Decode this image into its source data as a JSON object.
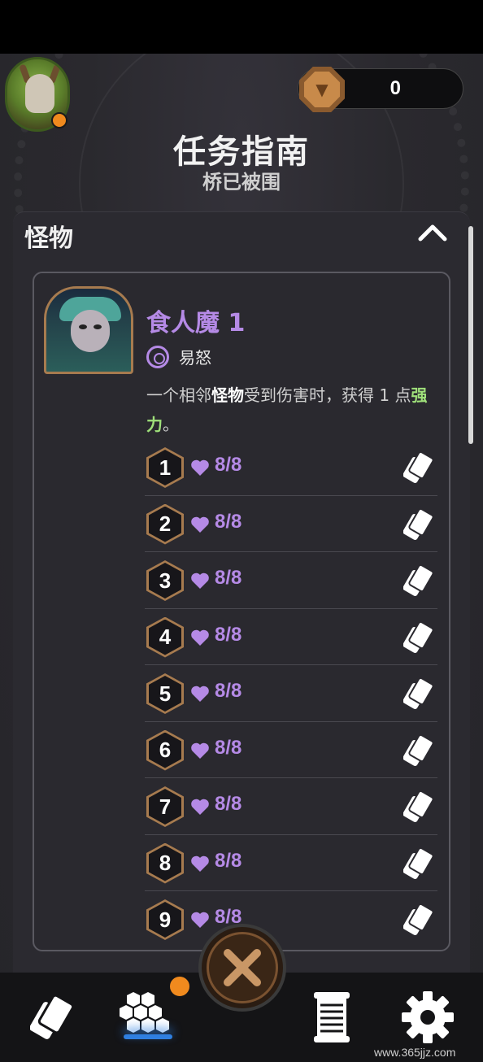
{
  "header": {
    "currency_value": "0",
    "title": "任务指南",
    "subtitle": "桥已被围"
  },
  "section": {
    "title": "怪物"
  },
  "monster": {
    "name": "食人魔 1",
    "trait": "易怒",
    "desc_parts": [
      "一个相邻",
      "怪物",
      "受到伤害时，获得 1 点",
      "强力",
      "。"
    ],
    "rows": [
      {
        "num": "1",
        "hp": "8/8"
      },
      {
        "num": "2",
        "hp": "8/8"
      },
      {
        "num": "3",
        "hp": "8/8"
      },
      {
        "num": "4",
        "hp": "8/8"
      },
      {
        "num": "5",
        "hp": "8/8"
      },
      {
        "num": "6",
        "hp": "8/8"
      },
      {
        "num": "7",
        "hp": "8/8"
      },
      {
        "num": "8",
        "hp": "8/8"
      },
      {
        "num": "9",
        "hp": "8/8"
      }
    ]
  },
  "nav": {
    "items": [
      "cards-icon",
      "hex-grid-icon",
      "crossed-swords-icon",
      "scroll-icon",
      "gear-icon"
    ]
  },
  "watermark": "www.365jjz.com",
  "colors": {
    "accent_purple": "#b58ae6",
    "keyword_green": "#9fe07a",
    "badge_orange": "#f08a1e",
    "bronze": "#a77b4f"
  }
}
